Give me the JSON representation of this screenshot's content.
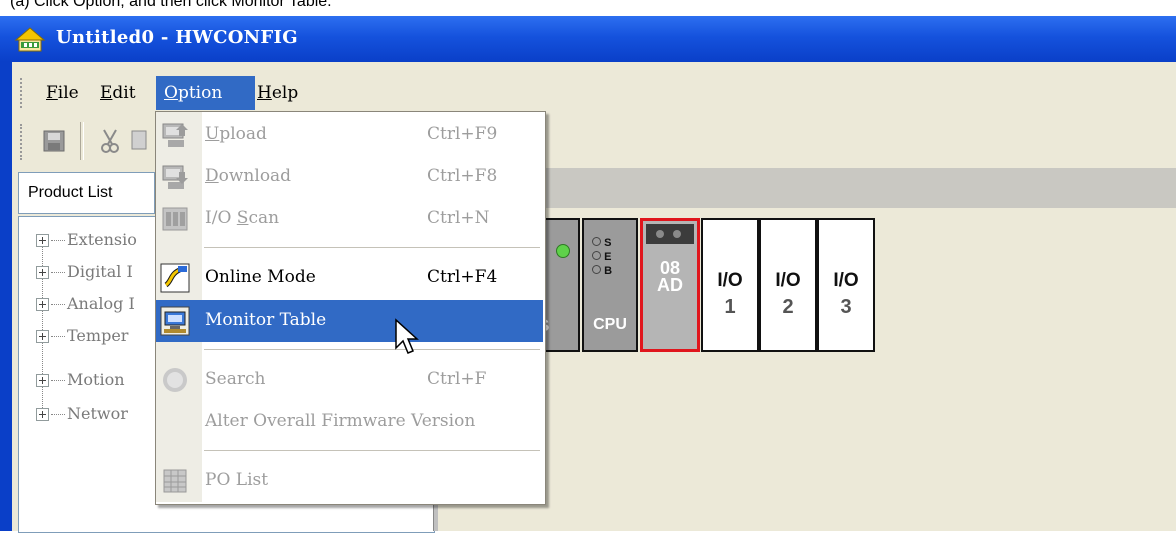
{
  "caption": "(a) Click Option, and then click Monitor Table.",
  "window": {
    "title": "Untitled0 - HWCONFIG"
  },
  "menubar": {
    "items": [
      {
        "label": "File"
      },
      {
        "label": "Edit"
      },
      {
        "label": "Option"
      },
      {
        "label": "Help"
      }
    ]
  },
  "option_menu": {
    "items": [
      {
        "label": "Upload",
        "shortcut": "Ctrl+F9",
        "icon": "upload-icon",
        "enabled": false
      },
      {
        "label": "Download",
        "shortcut": "Ctrl+F8",
        "icon": "download-icon",
        "enabled": false
      },
      {
        "label": "I/O Scan",
        "shortcut": "Ctrl+N",
        "icon": "io-scan-icon",
        "enabled": false
      },
      {
        "label": "Online Mode",
        "shortcut": "Ctrl+F4",
        "icon": "online-mode-icon",
        "enabled": true
      },
      {
        "label": "Monitor Table",
        "shortcut": "",
        "icon": "monitor-table-icon",
        "enabled": true,
        "highlighted": true
      },
      {
        "label": "Search",
        "shortcut": "Ctrl+F",
        "icon": "search-icon",
        "enabled": false
      },
      {
        "label": "Alter Overall Firmware Version",
        "shortcut": "",
        "icon": "",
        "enabled": false
      },
      {
        "label": "PO List",
        "shortcut": "",
        "icon": "po-list-icon",
        "enabled": false
      }
    ]
  },
  "product_list": {
    "label": "Product List",
    "tree": [
      "Extensio",
      "Digital I",
      "Analog I",
      "Temper",
      "Motion",
      "Networ"
    ]
  },
  "rack": {
    "modules": [
      {
        "label": "S"
      },
      {
        "label": "CPU",
        "leds": [
          "S",
          "E",
          "B"
        ]
      },
      {
        "label": "08\nAD",
        "line1": "08",
        "line2": "AD",
        "selected": true
      },
      {
        "label": "I/O",
        "num": "1"
      },
      {
        "label": "I/O",
        "num": "2"
      },
      {
        "label": "I/O",
        "num": "3"
      }
    ]
  },
  "colors": {
    "titlebar": "#1552dd",
    "highlight": "#316ac5",
    "selected_module_border": "#e0161d"
  }
}
